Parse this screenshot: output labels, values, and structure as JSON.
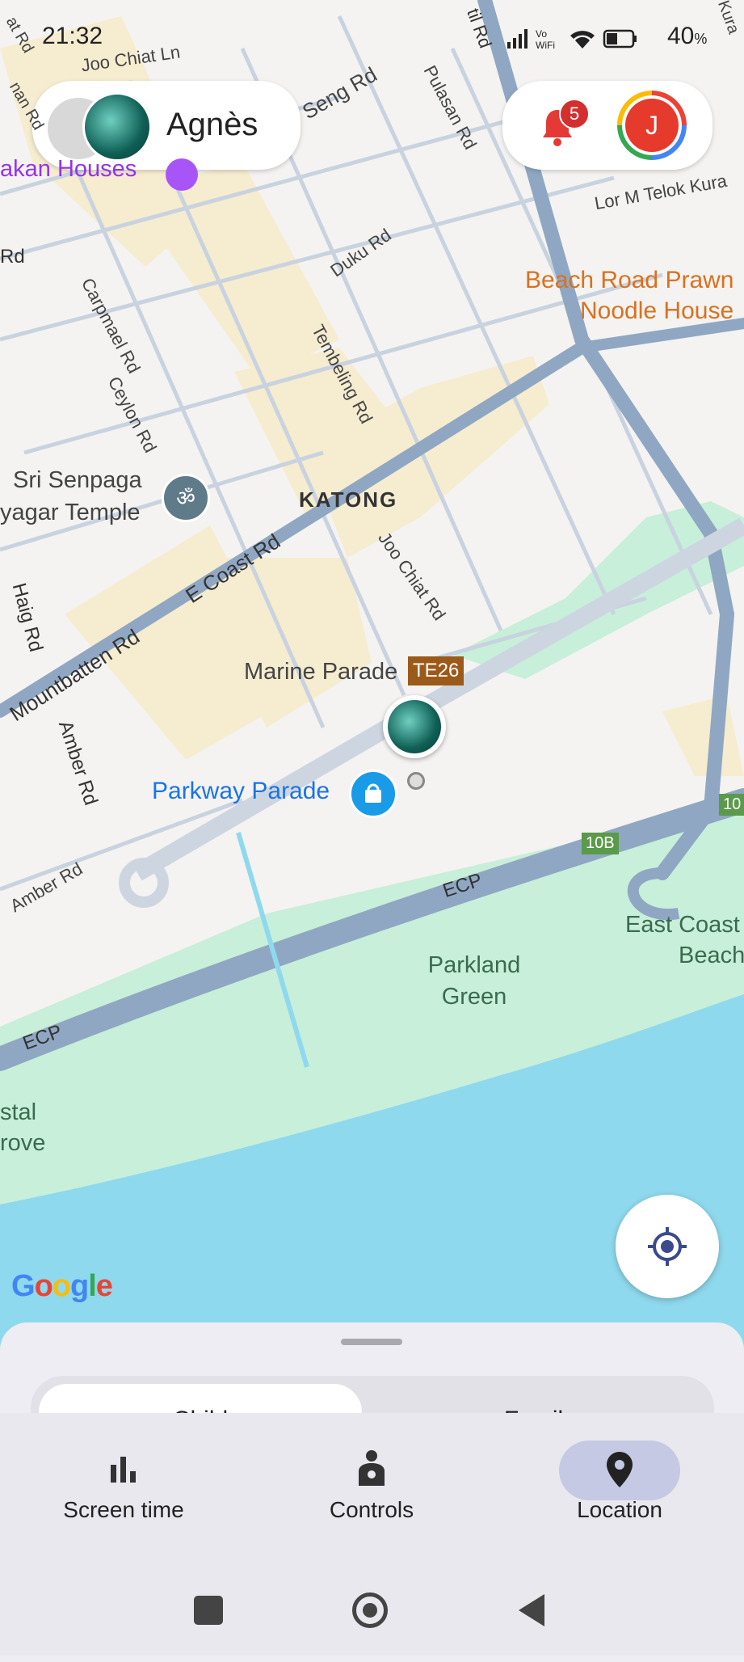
{
  "status_bar": {
    "time": "21:32",
    "battery": "40",
    "battery_unit": "%"
  },
  "header": {
    "child_name": "Agnès",
    "notification_count": "5",
    "account_initial": "J"
  },
  "map": {
    "area_label": "KATONG",
    "places": {
      "hawker": "akan Houses",
      "beach_road": "Beach Road Prawn",
      "beach_road2": "Noodle House",
      "sri1": "Sri Senpaga",
      "sri2": "yagar Temple",
      "marine": "Marine Parade",
      "marine_code": "TE26",
      "parkway": "Parkway Parade",
      "parkland1": "Parkland",
      "parkland2": "Green",
      "ecb1": "East Coast",
      "ecb2": "Beach",
      "coastal1": "stal",
      "coastal2": "rove"
    },
    "roads": {
      "joo_chiat_ln": "Joo Chiat Ln",
      "seng": "Seng Rd",
      "pulasan": "Pulasan Rd",
      "lor_telok": "Lor M Telok Kura",
      "duku": "Duku Rd",
      "carpmael": "Carpmael Rd",
      "ceylon": "Ceylon Rd",
      "tembeling": "Tembeling Rd",
      "e_coast": "E Coast Rd",
      "joo_chiat_rd": "Joo Chiat Rd",
      "mountbatten": "Mountbatten Rd",
      "haig": "Haig Rd",
      "amber": "Amber Rd",
      "amber2": "Amber Rd",
      "ecp": "ECP",
      "ecp2": "ECP",
      "exit_10b": "10B",
      "exit_10": "10",
      "rd_left": "Rd",
      "top_left": "at Rd",
      "top_left2": "nan Rd",
      "til": "til Rd",
      "kurau": "Kura"
    },
    "google_logo": "Google",
    "colors": {
      "water": "#8fd9ee",
      "park": "#c8efd9",
      "road": "#8fa7c2",
      "sand": "#f6ecd0"
    }
  },
  "bottom_sheet": {
    "tab_child": "Child",
    "tab_family": "Family"
  },
  "nav": {
    "items": [
      {
        "label": "Screen time",
        "icon": "bar-chart-icon",
        "selected": false
      },
      {
        "label": "Controls",
        "icon": "person-controls-icon",
        "selected": false
      },
      {
        "label": "Location",
        "icon": "location-pin-icon",
        "selected": true
      }
    ]
  },
  "system_nav": {
    "icons": [
      "recents-square-icon",
      "home-circle-icon",
      "back-triangle-icon"
    ]
  }
}
